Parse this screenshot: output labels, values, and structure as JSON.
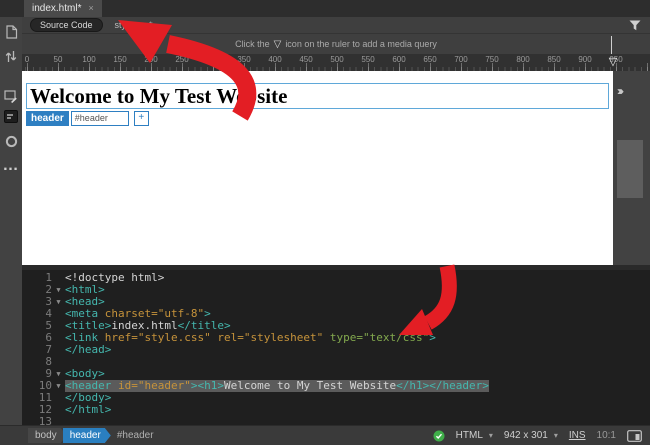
{
  "tab_bar": {
    "tab_title": "index.html*",
    "close_label": "×"
  },
  "related_files_bar": {
    "source_code_label": "Source Code",
    "css_file_label": "style.css*"
  },
  "hint_bar": {
    "before_icon": "Click the",
    "after_icon": "icon on the ruler to add a media query",
    "marker_glyph": "▽"
  },
  "ruler": {
    "labels": [
      "0",
      "50",
      "100",
      "150",
      "200",
      "250",
      "300",
      "350",
      "400",
      "450",
      "500",
      "550",
      "600",
      "650",
      "700",
      "750",
      "800",
      "850",
      "900",
      "950"
    ],
    "marker_glyph": "▽",
    "marker_value": 942
  },
  "toolbar": {
    "icons": [
      "open-documents",
      "file-management",
      "live-view",
      "code-snippets",
      "inspect-mode",
      "more-options"
    ]
  },
  "design_view": {
    "heading_text": "Welcome to My Test Website",
    "element_display": {
      "tag_label": "header",
      "id_value": "#header",
      "add_button": "+"
    },
    "overflow_chevrons": "››››"
  },
  "code_view": {
    "lines": [
      {
        "num": "1",
        "fold": "",
        "segments": [
          {
            "c": "plain",
            "t": "<!doctype html>"
          }
        ]
      },
      {
        "num": "2",
        "fold": "▼",
        "segments": [
          {
            "c": "tag",
            "t": "<html>"
          }
        ]
      },
      {
        "num": "3",
        "fold": "▼",
        "segments": [
          {
            "c": "tag",
            "t": "<head>"
          }
        ]
      },
      {
        "num": "4",
        "fold": "",
        "segments": [
          {
            "c": "tag",
            "t": "<meta "
          },
          {
            "c": "attr",
            "t": "charset=\"utf-8\""
          },
          {
            "c": "tag",
            "t": ">"
          }
        ]
      },
      {
        "num": "5",
        "fold": "",
        "segments": [
          {
            "c": "tag",
            "t": "<title>"
          },
          {
            "c": "plain",
            "t": "index.html"
          },
          {
            "c": "tag",
            "t": "</title>"
          }
        ]
      },
      {
        "num": "6",
        "fold": "",
        "segments": [
          {
            "c": "tag",
            "t": "<link "
          },
          {
            "c": "attr",
            "t": "href=\"style.css\" rel=\"stylesheet\" "
          },
          {
            "c": "green",
            "t": "type=\"text/css\""
          },
          {
            "c": "tag",
            "t": ">"
          }
        ]
      },
      {
        "num": "7",
        "fold": "",
        "segments": [
          {
            "c": "tag",
            "t": "</head>"
          }
        ]
      },
      {
        "num": "8",
        "fold": "",
        "segments": []
      },
      {
        "num": "9",
        "fold": "▼",
        "segments": [
          {
            "c": "tag",
            "t": "<body>"
          }
        ]
      },
      {
        "num": "10",
        "fold": "▼",
        "highlight": true,
        "segments": [
          {
            "c": "tag",
            "t": "<header "
          },
          {
            "c": "attr",
            "t": "id=\"header\""
          },
          {
            "c": "tag",
            "t": "><h1>"
          },
          {
            "c": "plain",
            "t": "Welcome to My Test Website"
          },
          {
            "c": "tag",
            "t": "</h1></header>"
          }
        ]
      },
      {
        "num": "11",
        "fold": "",
        "segments": [
          {
            "c": "tag",
            "t": "</body>"
          }
        ]
      },
      {
        "num": "12",
        "fold": "",
        "segments": [
          {
            "c": "tag",
            "t": "</html>"
          }
        ]
      },
      {
        "num": "13",
        "fold": "",
        "segments": []
      }
    ]
  },
  "status_bar": {
    "tag_path": [
      "body",
      "header",
      "#header"
    ],
    "doc_type_label": "HTML",
    "window_size_label": "942 x 301",
    "insert_mode_label": "INS",
    "position_label": "10:1"
  },
  "colors": {
    "accent_blue": "#2e7fc2",
    "code_tag": "#45b7ae",
    "code_attr": "#c6933b",
    "code_value_green": "#83a94e",
    "arrow_red": "#e31e24",
    "status_green": "#3fae49"
  }
}
